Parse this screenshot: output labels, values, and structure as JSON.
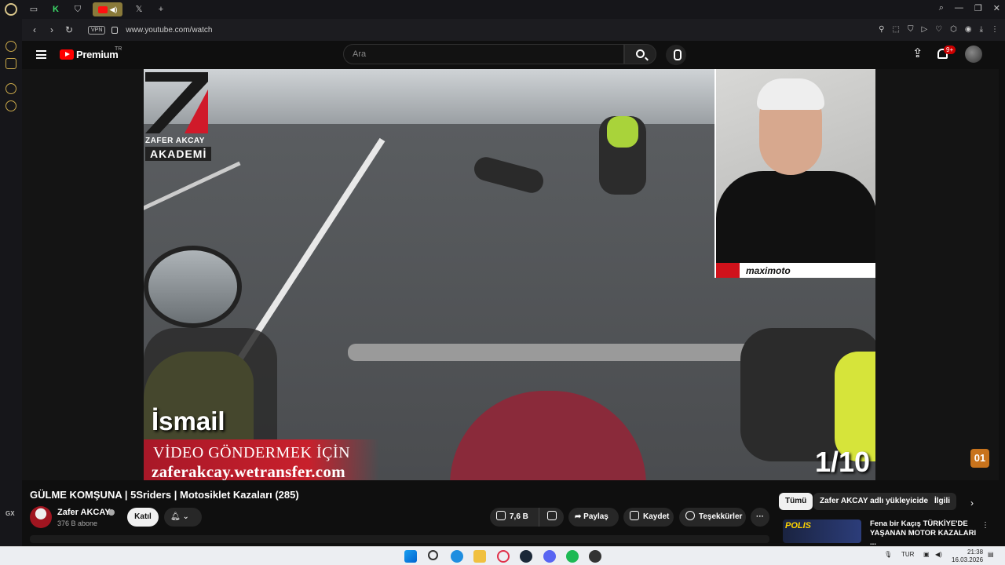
{
  "browser": {
    "url": "www.youtube.com/watch",
    "vpn_label": "VPN",
    "tabs": [
      {
        "icon": "wallet-icon"
      },
      {
        "icon": "k-app-icon"
      },
      {
        "icon": "shield-icon"
      },
      {
        "icon": "youtube-icon",
        "active": true
      },
      {
        "icon": "x-icon"
      },
      {
        "icon": "plus-icon"
      }
    ],
    "sidebar_label": "GX"
  },
  "youtube": {
    "logo_text": "Premium",
    "logo_region": "TR",
    "search_placeholder": "Ara",
    "notifications_badge": "9+"
  },
  "video": {
    "overlay": {
      "brand_name": "ZAFER AKCAY",
      "brand_sub": "AKADEMİ",
      "name_tag": "İsmail",
      "cta_line1": "VİDEO GÖNDERMEK İÇİN",
      "cta_line2": "zaferakcay.wetransfer.com",
      "counter": "1/10",
      "pip_brand": "maximoto",
      "watermark": "01"
    },
    "title": "GÜLME KOMŞUNA | 5Sriders | Motosiklet Kazaları (285)",
    "channel": {
      "name": "Zafer AKCAY",
      "subscribers": "376 B abone",
      "join_label": "Katıl"
    },
    "actions": {
      "like_count": "7,6 B",
      "share_label": "Paylaş",
      "save_label": "Kaydet",
      "thanks_label": "Teşekkürler"
    }
  },
  "related": {
    "chips": [
      "Tümü",
      "Zafer AKCAY adlı yükleyiciden",
      "İlgili"
    ],
    "first": {
      "thumb_text": "POLIS",
      "title": "Fena bir Kaçış TÜRKİYE'DE YAŞANAN MOTOR KAZALARI ..."
    }
  },
  "taskbar": {
    "language": "TUR",
    "time": "21:38",
    "date": "16.03.2026"
  },
  "colors": {
    "accent": "#ff0000",
    "background": "#0f0f0f",
    "opera_gold": "#c9a84a"
  }
}
